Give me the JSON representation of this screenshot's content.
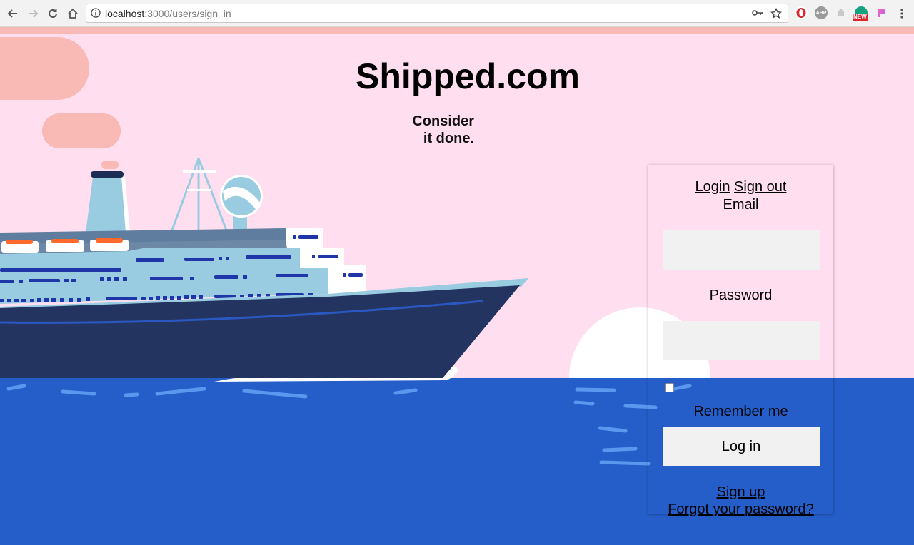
{
  "browser": {
    "url_host": "localhost",
    "url_path": ":3000/users/sign_in",
    "extensions": [
      "opera-icon",
      "adblock-plus-icon",
      "extension-puzzle-icon",
      "grammarly-icon",
      "gradient-extension-icon"
    ],
    "ext_abp_label": "ABP",
    "ext_new_badge": "NEW"
  },
  "site": {
    "title": "Shipped.com",
    "tagline_line1": "Consider",
    "tagline_line2": "it done."
  },
  "login": {
    "login_link": "Login",
    "signout_link": "Sign out",
    "email_label": "Email",
    "email_value": "",
    "password_label": "Password",
    "password_value": "",
    "remember_label": "Remember me",
    "remember_checked": false,
    "submit_label": "Log in",
    "signup_link": "Sign up",
    "forgot_link": "Forgot your password?"
  },
  "colors": {
    "sky": "#ffdfef",
    "sea": "#265ec9",
    "hull": "#233460",
    "cloud": "#f9b9b5",
    "ship_light": "#99cce0"
  }
}
